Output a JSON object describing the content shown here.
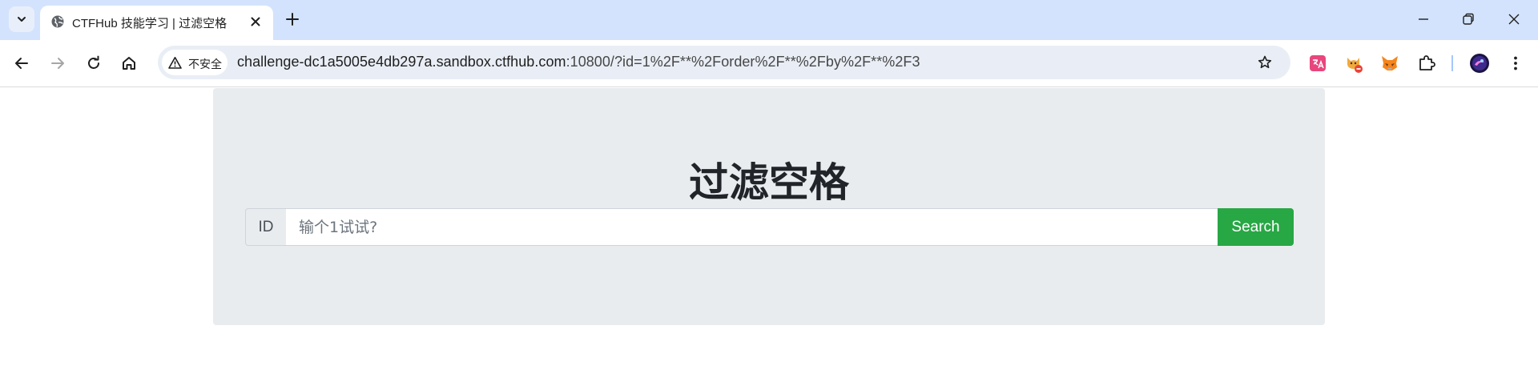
{
  "browser": {
    "tab": {
      "title": "CTFHub 技能学习 | 过滤空格"
    },
    "address_bar": {
      "security_label": "不安全",
      "url_host": "challenge-dc1a5005e4db297a.sandbox.ctfhub.com",
      "url_rest": ":10800/?id=1%2F**%2Forder%2F**%2Fby%2F**%2F3"
    },
    "icons": [
      "tab-search-icon",
      "globe-icon",
      "close-icon",
      "plus-icon",
      "minimize-icon",
      "restore-icon",
      "window-close-icon",
      "back-icon",
      "forward-icon",
      "reload-icon",
      "home-icon",
      "warning-icon",
      "bookmark-star-icon",
      "extension-icon",
      "puzzle-icon",
      "profile-avatar"
    ]
  },
  "page": {
    "heading": "过滤空格",
    "form": {
      "addon_label": "ID",
      "input_placeholder": "输个1试试?",
      "input_value": "",
      "button_label": "Search"
    }
  },
  "colors": {
    "tabstrip_bg": "#d3e3fd",
    "omnibox_bg": "#e9eef6",
    "jumbotron_bg": "#e9ecef",
    "search_button": "#28a745",
    "heading_text": "#212529"
  }
}
